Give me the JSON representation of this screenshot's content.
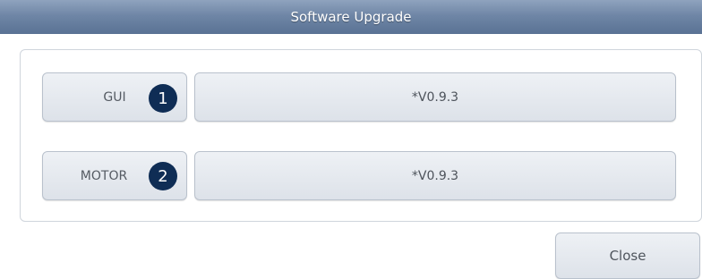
{
  "window": {
    "title": "Software Upgrade"
  },
  "rows": [
    {
      "label": "GUI",
      "badge": "1",
      "version": "*V0.9.3"
    },
    {
      "label": "MOTOR",
      "badge": "2",
      "version": "*V0.9.3"
    }
  ],
  "footer": {
    "close_label": "Close"
  },
  "colors": {
    "titlebar": "#6f86a6",
    "badge": "#0f2d55",
    "button": "#e4e8ee"
  }
}
